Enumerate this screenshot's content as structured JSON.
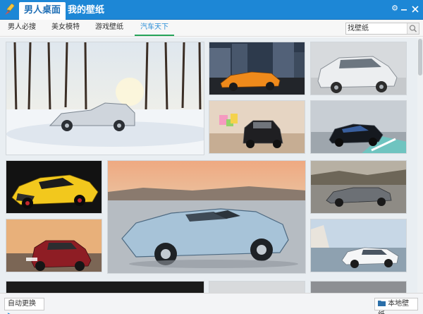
{
  "app": {
    "tabs": [
      {
        "label": "男人桌面",
        "active": true
      },
      {
        "label": "我的壁纸",
        "active": false
      }
    ],
    "window_buttons": [
      "settings",
      "minimize",
      "close"
    ]
  },
  "subnav": {
    "tabs": [
      {
        "label": "男人必搜"
      },
      {
        "label": "美女模特"
      },
      {
        "label": "游戏壁纸"
      },
      {
        "label": "汽车天下",
        "active": true
      }
    ],
    "search": {
      "value": "",
      "placeholder": "找壁纸"
    }
  },
  "gallery": {
    "category": "汽车天下",
    "thumbnails": [
      {
        "scene": "白色轿车雪地森林",
        "icon": "car-wallpaper"
      },
      {
        "scene": "橙色跑车城市夜景",
        "icon": "car-wallpaper"
      },
      {
        "scene": "银色掀背车",
        "icon": "car-wallpaper"
      },
      {
        "scene": "黑色SUV",
        "icon": "car-wallpaper"
      },
      {
        "scene": "黑色超跑赛道",
        "icon": "car-wallpaper"
      },
      {
        "scene": "黄色跑车",
        "icon": "car-wallpaper"
      },
      {
        "scene": "银色敞篷概念跑车",
        "icon": "car-wallpaper"
      },
      {
        "scene": "银色敞篷跑车",
        "icon": "car-wallpaper"
      },
      {
        "scene": "红色SUV",
        "icon": "car-wallpaper"
      },
      {
        "scene": "白色轿车海岸",
        "icon": "car-wallpaper"
      }
    ]
  },
  "footer": {
    "auto_change_label": "自动更换",
    "local_wallpaper_label": "本地壁纸"
  },
  "colors": {
    "title_bar": "#1d87d6",
    "active_tab_text": "#2a8ed7",
    "active_tab_underline": "#26a55a"
  }
}
